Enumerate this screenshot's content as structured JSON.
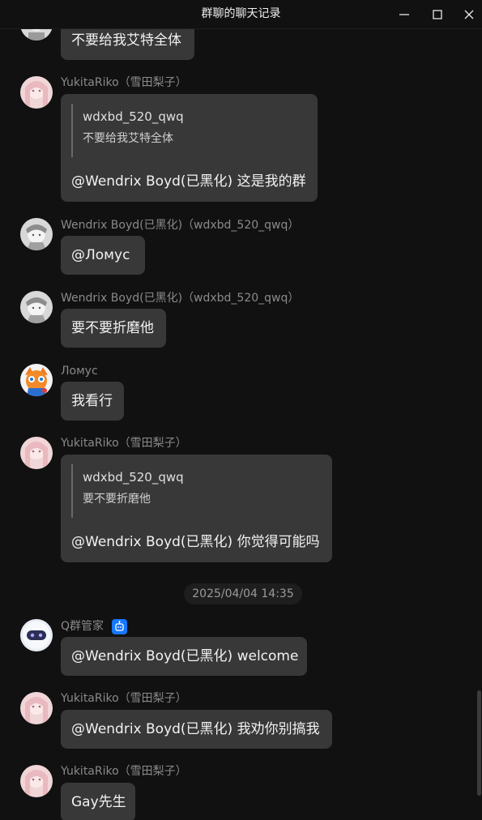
{
  "window": {
    "title": "群聊的聊天记录"
  },
  "messages": [
    {
      "name": "",
      "text": "不要给我艾特全体"
    },
    {
      "name": "YukitaRiko（雪田梨子）",
      "quote_name": "wdxbd_520_qwq",
      "quote_text": "不要给我艾特全体",
      "text": "@Wendrix Boyd(已黑化) 这是我的群"
    },
    {
      "name": "Wendrix Boyd(已黑化)（wdxbd_520_qwq）",
      "text": "@Ломус"
    },
    {
      "name": "Wendrix Boyd(已黑化)（wdxbd_520_qwq）",
      "text": "要不要折磨他"
    },
    {
      "name": "Ломус",
      "text": "我看行"
    },
    {
      "name": "YukitaRiko（雪田梨子）",
      "quote_name": "wdxbd_520_qwq",
      "quote_text": "要不要折磨他",
      "text": "@Wendrix Boyd(已黑化) 你觉得可能吗"
    },
    {
      "name": "Q群管家",
      "text": "@Wendrix Boyd(已黑化) welcome"
    },
    {
      "name": "YukitaRiko（雪田梨子）",
      "text": "@Wendrix Boyd(已黑化) 我劝你别搞我"
    },
    {
      "name": "YukitaRiko（雪田梨子）",
      "text": "Gay先生"
    }
  ],
  "timestamp": "2025/04/04 14:35",
  "colors": {
    "background": "#111111",
    "bubble": "#383838",
    "name": "#8a8a8a",
    "bot_badge": "#1677ff"
  },
  "icons": {
    "minimize": "minimize-icon",
    "maximize": "maximize-icon",
    "close": "close-icon",
    "bot_badge": "robot-badge-icon"
  }
}
